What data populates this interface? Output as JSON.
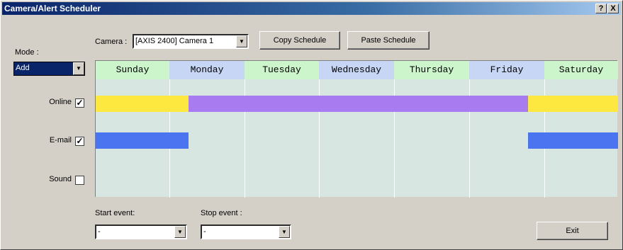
{
  "window": {
    "title": "Camera/Alert Scheduler",
    "help_glyph": "?",
    "close_glyph": "X"
  },
  "mode": {
    "label": "Mode :",
    "selected": "Add"
  },
  "camera": {
    "label": "Camera :",
    "selected": "[AXIS 2400] Camera 1"
  },
  "buttons": {
    "copy": "Copy Schedule",
    "paste": "Paste Schedule",
    "exit": "Exit"
  },
  "days": [
    {
      "label": "Sunday",
      "color": "#ccf5cc"
    },
    {
      "label": "Monday",
      "color": "#c7d6f5"
    },
    {
      "label": "Tuesday",
      "color": "#ccf5cc"
    },
    {
      "label": "Wednesday",
      "color": "#c7d6f5"
    },
    {
      "label": "Thursday",
      "color": "#ccf5cc"
    },
    {
      "label": "Friday",
      "color": "#c7d6f5"
    },
    {
      "label": "Saturday",
      "color": "#ccf5cc"
    }
  ],
  "rows": [
    {
      "label": "Online",
      "checked": true
    },
    {
      "label": "E-mail",
      "checked": true
    },
    {
      "label": "Sound",
      "checked": false
    }
  ],
  "events": {
    "start_label": "Start event:",
    "start_value": "-",
    "stop_label": "Stop event :",
    "stop_value": "-"
  },
  "colors": {
    "online_primary": "#fde840",
    "online_secondary": "#a87cf0",
    "email": "#4a74f0"
  }
}
